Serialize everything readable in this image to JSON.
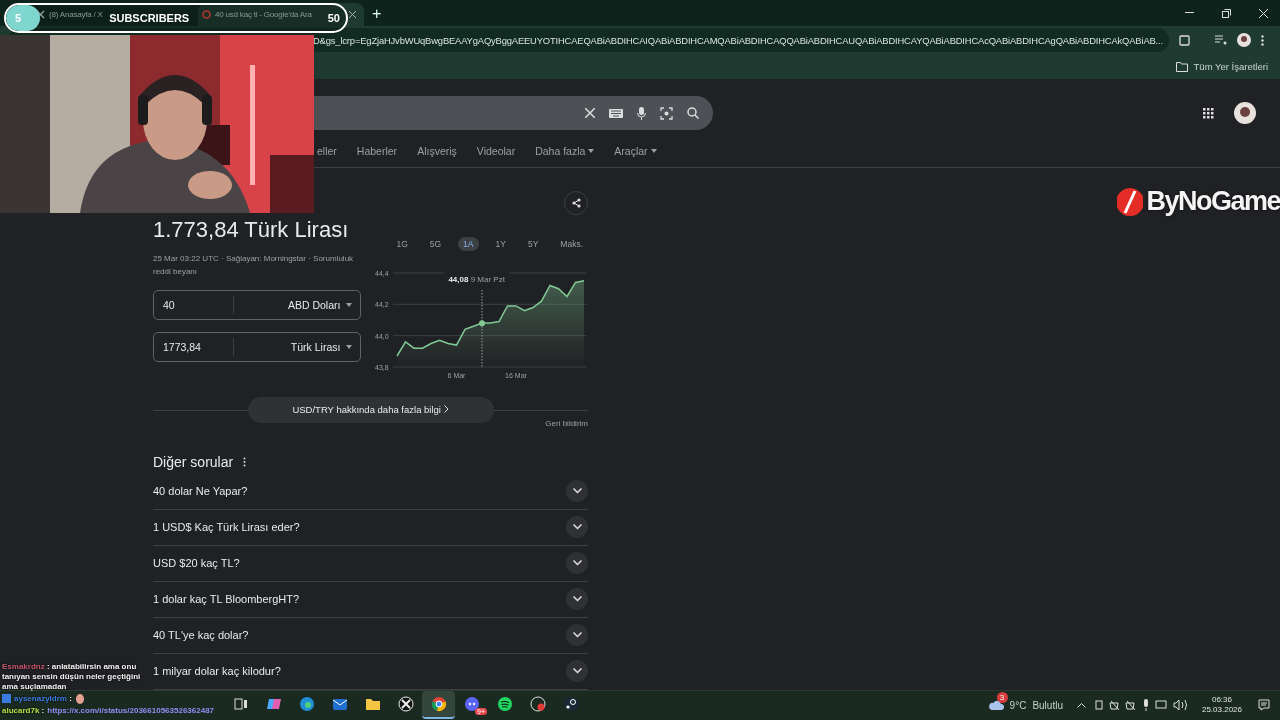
{
  "browser": {
    "tabs": [
      {
        "title": "(8) Anasayfa / X",
        "kind": "x",
        "selected": false
      },
      {
        "title": "40 usd kaç tl - Google'da Ara",
        "kind": "google",
        "selected": true
      }
    ],
    "new_tab": "+",
    "address": "D&gs_lcrp=EgZjaHJvbWUqBwgBEAAYgAQyBggAEEUYOTIHCAEQABiABDIHCAIQABiABDIHCAMQABiABDIHCAQQABiABDIHCAUQABiABDIHCAYQABiABDIHCAcQABiABDIHCAgQABiABDIHCAkQABiAB...",
    "bookmarks": "Tüm Yer İşaretleri"
  },
  "search": {
    "nav": [
      {
        "label": "eller",
        "dropdown": false
      },
      {
        "label": "Haberler",
        "dropdown": false
      },
      {
        "label": "Alışveriş",
        "dropdown": false
      },
      {
        "label": "Videolar",
        "dropdown": false
      },
      {
        "label": "Daha fazla",
        "dropdown": true
      },
      {
        "label": "Araçlar",
        "dropdown": true
      }
    ]
  },
  "result": {
    "amount": "1.773,84 Türk Lirası",
    "meta": "25 Mar 03:22 UTC · Sağlayan: Morningstar · Sorumluluk reddi beyanı",
    "converter": [
      {
        "value": "40",
        "currency": "ABD Doları"
      },
      {
        "value": "1773,84",
        "currency": "Türk Lirası"
      }
    ],
    "ranges": [
      {
        "label": "1G",
        "selected": false
      },
      {
        "label": "5G",
        "selected": false
      },
      {
        "label": "1A",
        "selected": true
      },
      {
        "label": "1Y",
        "selected": false
      },
      {
        "label": "5Y",
        "selected": false
      },
      {
        "label": "Maks.",
        "selected": false
      }
    ],
    "chart_data": {
      "type": "area",
      "categories": [
        null,
        null,
        null,
        null,
        null,
        null,
        null,
        "6 Mar",
        null,
        null,
        null,
        null,
        null,
        null,
        "16 Mar",
        null,
        null,
        null,
        null,
        null,
        null,
        null,
        null
      ],
      "series": [
        {
          "color": "#81c995",
          "values": [
            43.87,
            43.96,
            43.92,
            43.92,
            43.95,
            43.97,
            43.95,
            43.94,
            44.04,
            44.06,
            44.08,
            44.08,
            44.09,
            44.19,
            44.19,
            44.16,
            44.18,
            44.22,
            44.32,
            44.3,
            44.25,
            44.34,
            44.35
          ]
        }
      ],
      "ylim": [
        43.8,
        44.4
      ],
      "yticks": [
        {
          "value": 43.8,
          "label": "43,8"
        },
        {
          "value": 44.0,
          "label": "44,0"
        },
        {
          "value": 44.2,
          "label": "44,2"
        },
        {
          "value": 44.4,
          "label": "44,4"
        }
      ],
      "annotations": [
        "**44,08** 9 Mar Pzt"
      ]
    },
    "more_info": "USD/TRY hakkında daha fazla bilgi",
    "feedback": "Geri bildirim"
  },
  "related": {
    "title": "Diğer sorular",
    "questions": [
      "40 dolar Ne Yapar?",
      "1 USD$ Kaç Türk Lirası eder?",
      "USD $20 kaç TL?",
      "1 dolar kaç TL BloombergHT?",
      "40 TL'ye kaç dolar?",
      "1 milyar dolar kaç kilodur?"
    ]
  },
  "stream_overlay": {
    "subscribers": {
      "count": "5",
      "label": "SUBSCRIBERS",
      "goal": "50",
      "level": 0.1
    },
    "logo": "ByNoGame",
    "chat": [
      {
        "user": "Esmakrdnz",
        "color": "#c4566e",
        "message": ": anlatabilirsin ama onu tanıyan sensin düşün neler geçtiğini ama suçlamadan",
        "emote": false,
        "badges": false
      },
      {
        "user": "aysenazyldrm",
        "color": "#3b7be0",
        "message": ":",
        "emote": true,
        "badges": true
      },
      {
        "user": "alucard7k",
        "color": "#b8e04a",
        "message": ":",
        "link": "https://x.com/i/status/2036610563526362487",
        "emote": false,
        "badges": false
      }
    ]
  },
  "taskbar": {
    "apps": [
      {
        "kind": "taskview",
        "active": false
      },
      {
        "kind": "copilot",
        "active": false
      },
      {
        "kind": "edge",
        "active": false
      },
      {
        "kind": "outlook",
        "active": false
      },
      {
        "kind": "explorer",
        "active": false
      },
      {
        "kind": "xbox",
        "active": false
      },
      {
        "kind": "chrome",
        "active": true
      },
      {
        "kind": "discord",
        "active": false,
        "badge": "9+"
      },
      {
        "kind": "spotify",
        "active": false
      },
      {
        "kind": "recorder",
        "active": false
      },
      {
        "kind": "steam",
        "active": false
      }
    ],
    "weather": {
      "badge": "3",
      "temp": "9°C",
      "condition": "Bulutlu"
    },
    "time": "06:36",
    "date": "25.03.2026"
  }
}
